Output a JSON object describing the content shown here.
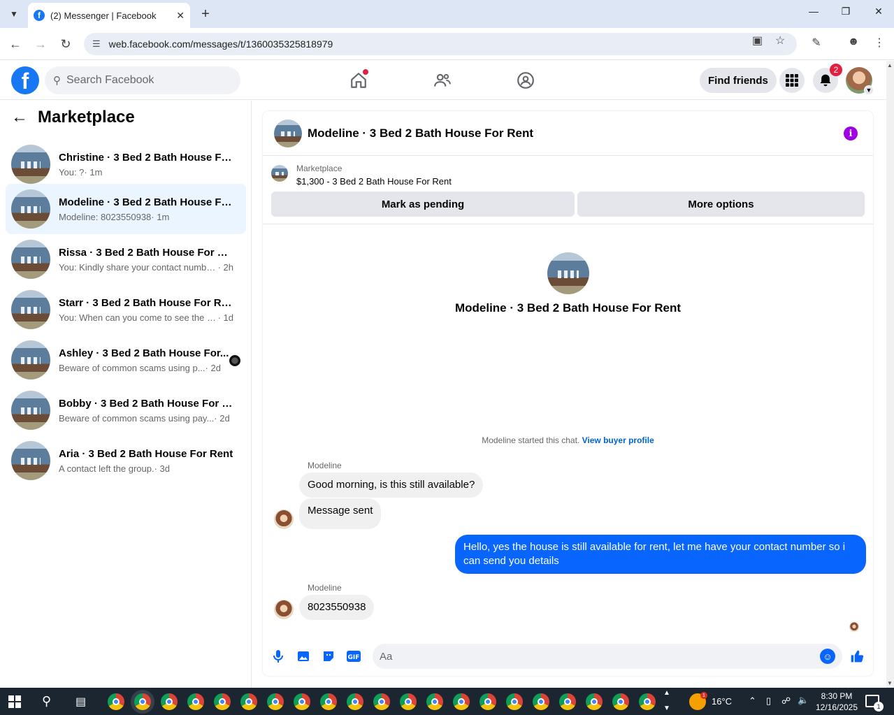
{
  "browser": {
    "tab_title": "(2) Messenger | Facebook",
    "url": "web.facebook.com/messages/t/1360035325818979"
  },
  "fb_header": {
    "search_placeholder": "Search Facebook",
    "find_friends_label": "Find friends",
    "notification_count": "2"
  },
  "sidebar": {
    "title": "Marketplace",
    "conversations": [
      {
        "name": "Christine · 3 Bed 2 Bath House For ...",
        "preview": "You: ?",
        "time": "· 1m"
      },
      {
        "name": "Modeline · 3 Bed 2 Bath House Fo...",
        "preview": "Modeline: 8023550938",
        "time": "· 1m"
      },
      {
        "name": "Rissa · 3 Bed 2 Bath House For Rent",
        "preview": "You: Kindly share your contact numbe...",
        "time": "· 2h"
      },
      {
        "name": "Starr · 3 Bed 2 Bath House For Rent",
        "preview": "You: When can you come to see the h...",
        "time": "· 1d"
      },
      {
        "name": "Ashley · 3 Bed 2 Bath House For...",
        "preview": "Beware of common scams using p...",
        "time": "· 2d"
      },
      {
        "name": "Bobby · 3 Bed 2 Bath House For R...",
        "preview": "Beware of common scams using pay...",
        "time": "· 2d"
      },
      {
        "name": "Aria · 3 Bed 2 Bath House For Rent",
        "preview": "A contact left the group.",
        "time": "· 3d"
      }
    ]
  },
  "chat": {
    "title": "Modeline · 3 Bed 2 Bath House For Rent",
    "marketplace_label": "Marketplace",
    "listing": "$1,300 - 3 Bed 2 Bath House For Rent",
    "mark_pending_label": "Mark as pending",
    "more_options_label": "More options",
    "intro_name": "Modeline · 3 Bed 2 Bath House For Rent",
    "started_text": "Modeline started this chat.",
    "view_profile_label": "View buyer profile",
    "messages": [
      {
        "sender": "Modeline",
        "text": "Good morning, is this still available?"
      },
      {
        "text": "Message sent"
      },
      {
        "text": "Hello, yes the house is still available for rent, let me have your contact number so i can send you  details"
      },
      {
        "sender": "Modeline",
        "text": "8023550938"
      }
    ],
    "composer_placeholder": "Aa"
  },
  "taskbar": {
    "temperature": "16°C",
    "time": "8:30 PM",
    "date": "12/16/2025",
    "notification_count": "1"
  }
}
